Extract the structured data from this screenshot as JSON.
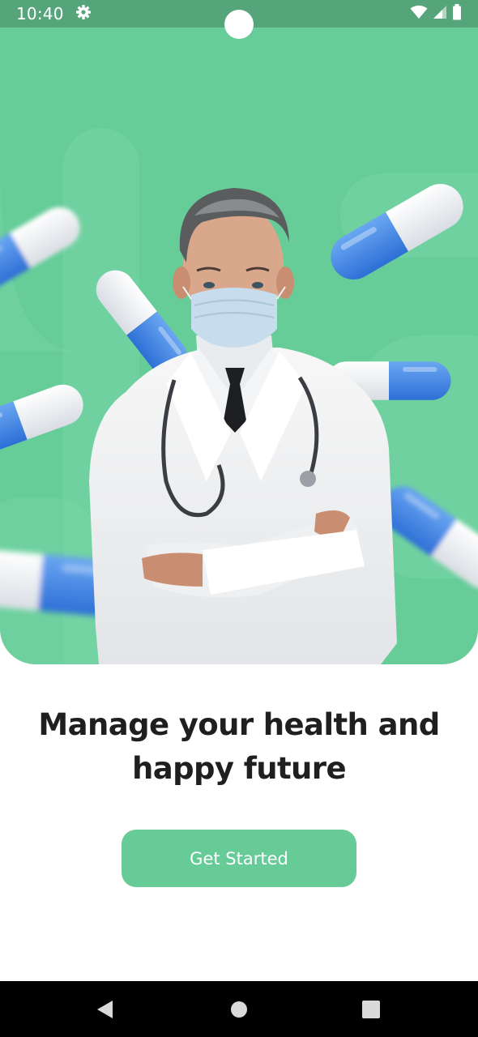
{
  "status_bar": {
    "time": "10:40",
    "icons": [
      "settings-gear-icon",
      "wifi-icon",
      "cellular-signal-icon",
      "battery-icon"
    ],
    "background": "#55a47a"
  },
  "hero": {
    "background": "#66cc98",
    "image": "doctor-in-mask-with-stethoscope",
    "decorations": [
      "blue-white-capsule"
    ]
  },
  "headline": {
    "line1": "Manage your health and",
    "line2": "happy future"
  },
  "cta": {
    "label": "Get Started",
    "color": "#66cb97"
  },
  "nav_bar": {
    "icons": [
      "back-triangle-icon",
      "home-circle-icon",
      "recents-square-icon"
    ]
  }
}
